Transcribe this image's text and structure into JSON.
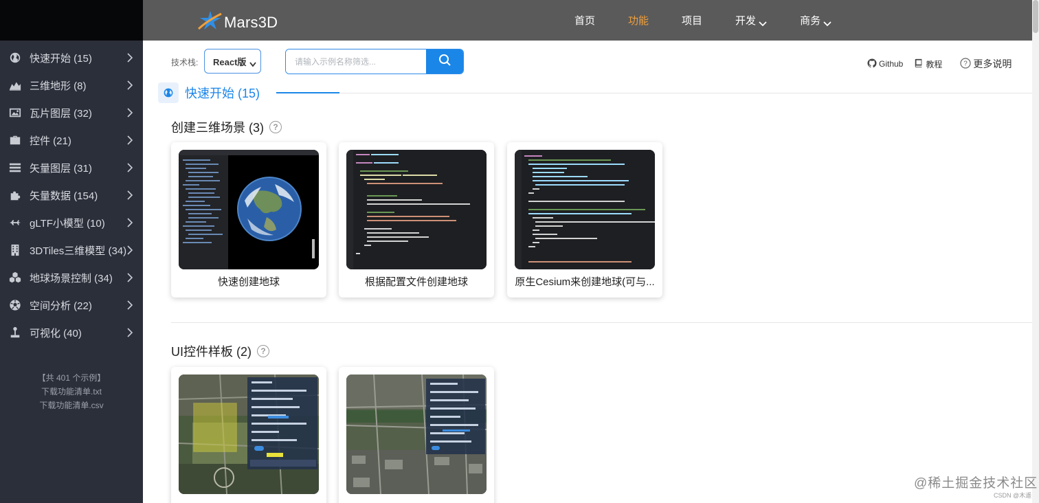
{
  "sidebar": {
    "items": [
      {
        "label": "快速开始 (15)",
        "icon": "globe-icon"
      },
      {
        "label": "三维地形 (8)",
        "icon": "terrain-icon"
      },
      {
        "label": "瓦片图层 (32)",
        "icon": "image-icon"
      },
      {
        "label": "控件 (21)",
        "icon": "briefcase-icon"
      },
      {
        "label": "矢量图层 (31)",
        "icon": "layers-icon"
      },
      {
        "label": "矢量数据 (154)",
        "icon": "puzzle-icon"
      },
      {
        "label": "gLTF小模型 (10)",
        "icon": "plane-icon"
      },
      {
        "label": "3DTiles三维模型 (34)",
        "icon": "building-icon"
      },
      {
        "label": "地球场景控制 (34)",
        "icon": "cubes-icon"
      },
      {
        "label": "空间分析 (22)",
        "icon": "football-icon"
      },
      {
        "label": "可视化 (40)",
        "icon": "joystick-icon"
      }
    ],
    "summary": "【共 401 个示例】",
    "download_txt": "下载功能清单.txt",
    "download_csv": "下载功能清单.csv"
  },
  "header": {
    "logo_text": "Mars3D",
    "nav": [
      {
        "label": "首页",
        "active": false
      },
      {
        "label": "功能",
        "active": true
      },
      {
        "label": "项目",
        "active": false
      },
      {
        "label": "开发",
        "active": false,
        "dropdown": true
      },
      {
        "label": "商务",
        "active": false,
        "dropdown": true
      }
    ],
    "active_color": "#f0a03c"
  },
  "toolbar": {
    "tech_label": "技术栈:",
    "tech_value": "React版",
    "search_placeholder": "请输入示例名称筛选...",
    "links": {
      "github": "Github",
      "tutorial": "教程",
      "more": "更多说明"
    }
  },
  "section": {
    "title": "快速开始 (15)",
    "accent": "#1a86e8"
  },
  "groups": [
    {
      "title": "创建三维场景 (3)",
      "cards": [
        {
          "label": "快速创建地球",
          "thumb": "globe-thumbnail"
        },
        {
          "label": "根据配置文件创建地球",
          "thumb": "code-thumbnail"
        },
        {
          "label": "原生Cesium来创建地球(可与...",
          "thumb": "code-thumbnail"
        }
      ]
    },
    {
      "title": "UI控件样板 (2)",
      "cards": [
        {
          "label": "",
          "thumb": "map-thumbnail"
        },
        {
          "label": "",
          "thumb": "map-thumbnail"
        }
      ]
    }
  ],
  "watermark": "@稀土掘金技术社区",
  "watermark_small": "CSDN @木遥"
}
